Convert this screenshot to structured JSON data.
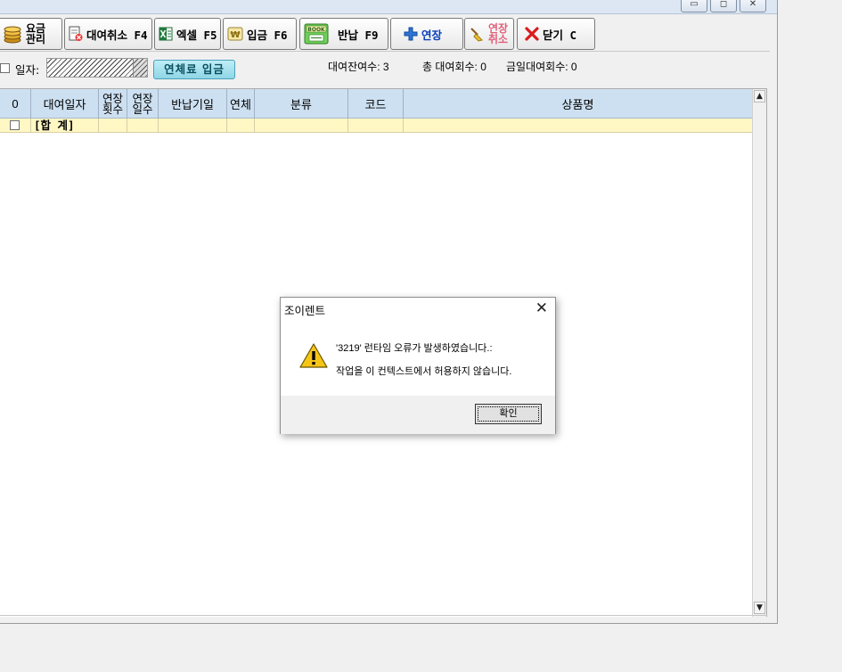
{
  "window": {
    "controls": {
      "minimize": "▭",
      "maximize": "◻",
      "close": "✕"
    }
  },
  "toolbar": {
    "fee_manage_label_1": "요금",
    "fee_manage_label_2": "관리",
    "rent_cancel_label": "대여취소 F4",
    "excel_label": "엑셀 F5",
    "deposit_label": "입금 F6",
    "return_label": "반납 F9",
    "extend_label": "연장",
    "extend_cancel_label_1": "연장",
    "extend_cancel_label_2": "취소",
    "close_label": "닫기 C",
    "colors": {
      "extend_text": "#0a3fb8",
      "extend_cancel_text": "#e0607a",
      "close_icon": "#d81c1c"
    }
  },
  "filter": {
    "date_label": "일자:",
    "late_fee_button": "연체료 입금"
  },
  "stats": {
    "remaining": "대여잔여수: 3",
    "total": "총 대여회수: 0",
    "today": "금일대여회수: 0"
  },
  "grid": {
    "headers": {
      "check": "0",
      "rent_date": "대여일자",
      "ext_count_1": "연장",
      "ext_count_2": "횟수",
      "ext_days_1": "연장",
      "ext_days_2": "일수",
      "return_due": "반납기일",
      "overdue": "연체",
      "category": "분류",
      "code": "코드",
      "product": "상품명"
    },
    "summary_label": "[합 계]",
    "colors": {
      "header_bg": "#cde0f1",
      "summary_bg": "#fff7c4"
    }
  },
  "dialog": {
    "title": "조이렌트",
    "close": "✕",
    "message_line1": "'3219' 런타임 오류가 발생하였습니다.:",
    "message_line2": "작업을 이 컨텍스트에서 허용하지 않습니다.",
    "ok_label": "확인",
    "icon": "warning-icon"
  }
}
